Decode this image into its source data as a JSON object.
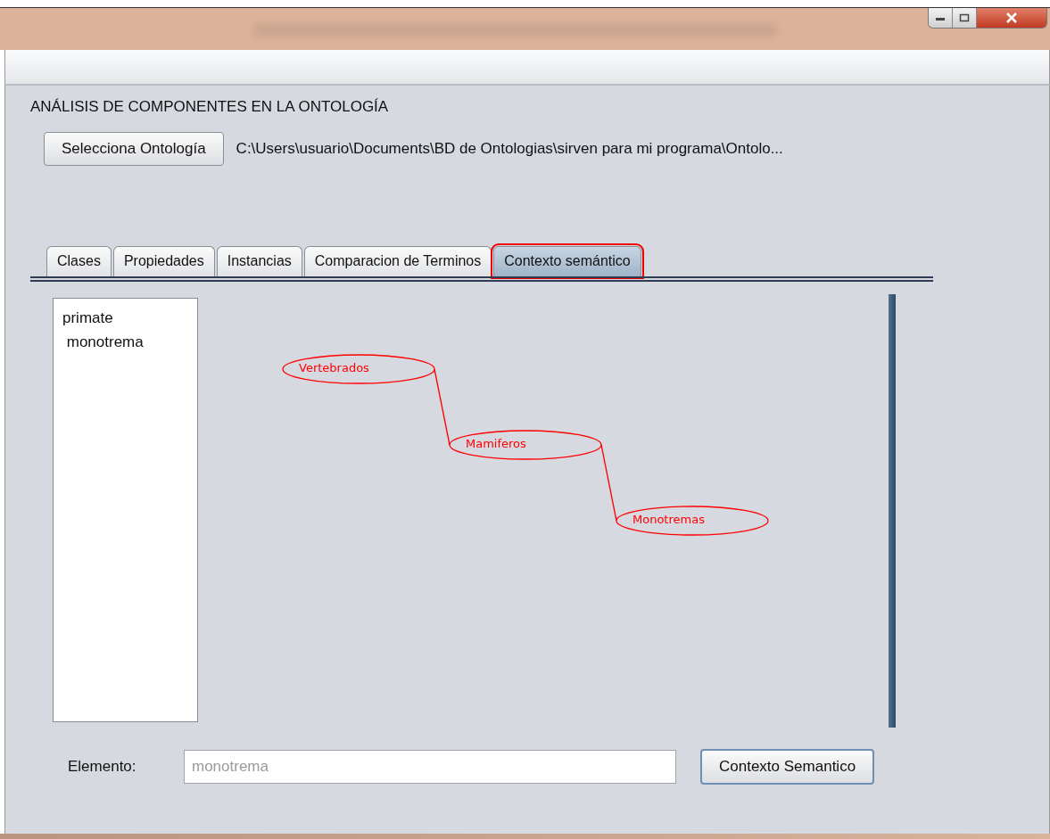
{
  "heading": "ANÁLISIS DE COMPONENTES EN LA ONTOLOGÍA",
  "select_button": "Selecciona Ontología",
  "path": "C:\\Users\\usuario\\Documents\\BD de Ontologias\\sirven para mi programa\\Ontolo...",
  "tabs": [
    {
      "label": "Clases",
      "selected": false
    },
    {
      "label": "Propiedades",
      "selected": false
    },
    {
      "label": "Instancias",
      "selected": false
    },
    {
      "label": "Comparacion de Terminos",
      "selected": false
    },
    {
      "label": "Contexto semántico",
      "selected": true
    }
  ],
  "list_items": [
    "primate",
    " monotrema"
  ],
  "graph": {
    "label": "Vertebrados",
    "children": [
      {
        "label": "Mamiferos",
        "children": [
          {
            "label": "Monotremas"
          }
        ]
      }
    ]
  },
  "element_label": "Elemento:",
  "element_field": {
    "placeholder": "monotrema"
  },
  "context_button": "Contexto Semantico"
}
